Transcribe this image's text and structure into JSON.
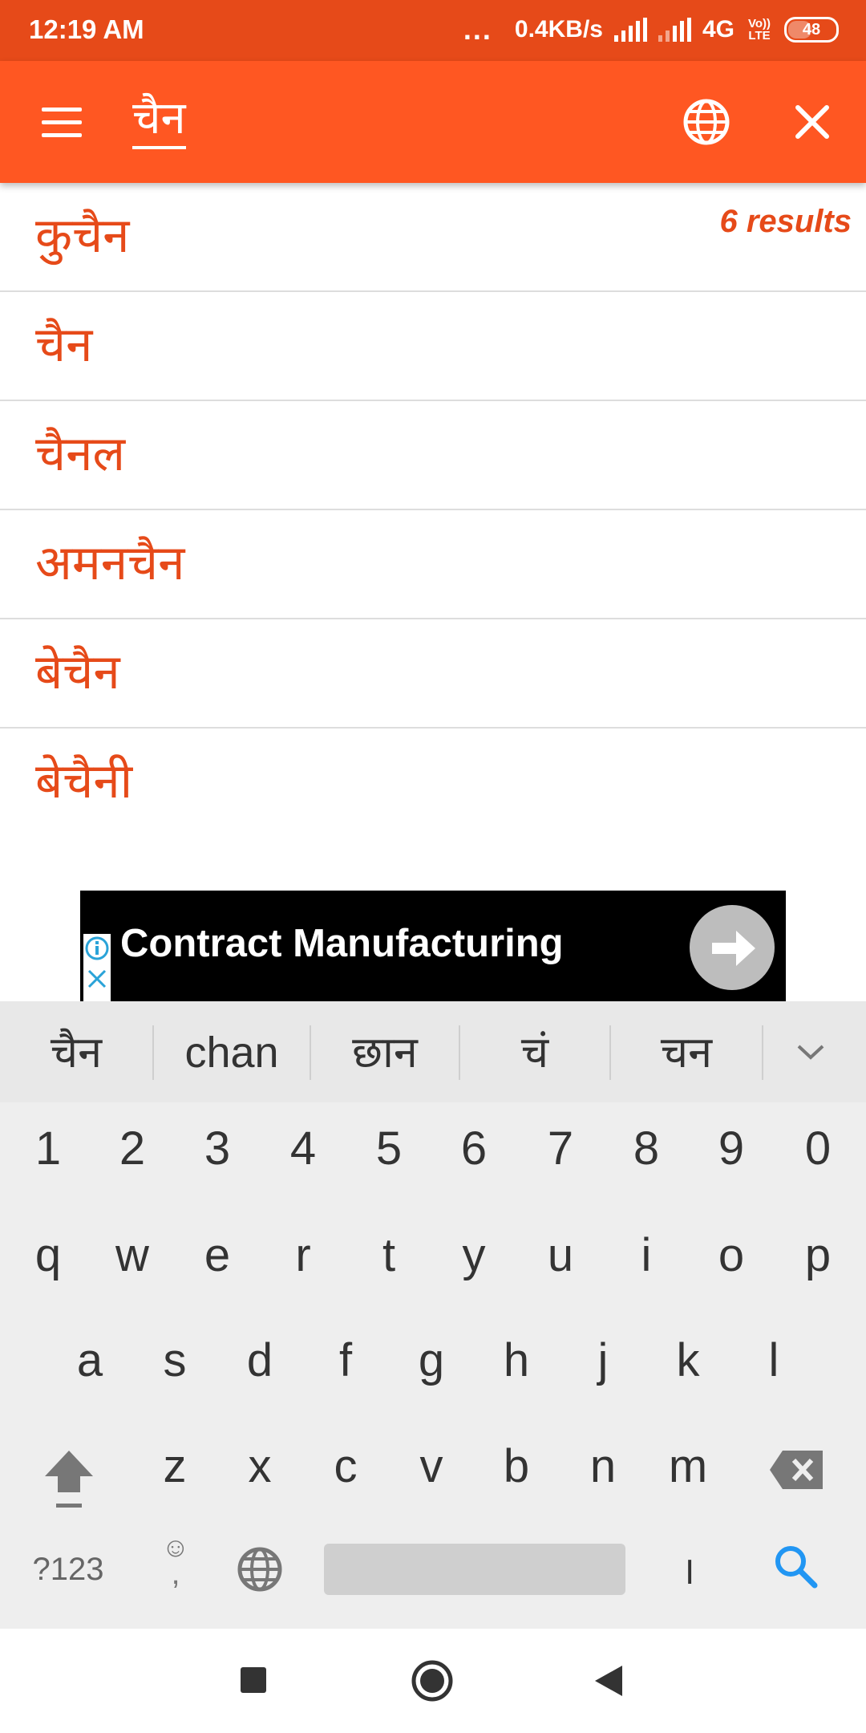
{
  "status_bar": {
    "time": "12:19 AM",
    "more": "...",
    "speed": "0.4KB/s",
    "network": "4G",
    "volte": "Vo)) LTE",
    "battery": "48"
  },
  "toolbar": {
    "query": "चैन",
    "menu_icon": "hamburger-menu-icon",
    "language_icon": "globe-icon",
    "close_icon": "close-icon"
  },
  "results": {
    "count_label": "6 results",
    "items": [
      "कुचैन",
      "चैन",
      "चैनल",
      "अमनचैन",
      "बेचैन",
      "बेचैनी"
    ]
  },
  "ad": {
    "text": "Contract Manufacturing"
  },
  "keyboard": {
    "suggestions": [
      "चैन",
      "chan",
      "छान",
      "चं",
      "चन"
    ],
    "numbers": [
      "1",
      "2",
      "3",
      "4",
      "5",
      "6",
      "7",
      "8",
      "9",
      "0"
    ],
    "row1": [
      "q",
      "w",
      "e",
      "r",
      "t",
      "y",
      "u",
      "i",
      "o",
      "p"
    ],
    "row2": [
      "a",
      "s",
      "d",
      "f",
      "g",
      "h",
      "j",
      "k",
      "l"
    ],
    "row3": [
      "z",
      "x",
      "c",
      "v",
      "b",
      "n",
      "m"
    ],
    "symbols_label": "?123",
    "emoji_key": "☺",
    "emoji_sub": ",",
    "danda_key": "।"
  },
  "colors": {
    "status_bar": "#e64a19",
    "toolbar": "#ff5722",
    "result_text": "#e64a19",
    "search_key": "#2196f3"
  }
}
